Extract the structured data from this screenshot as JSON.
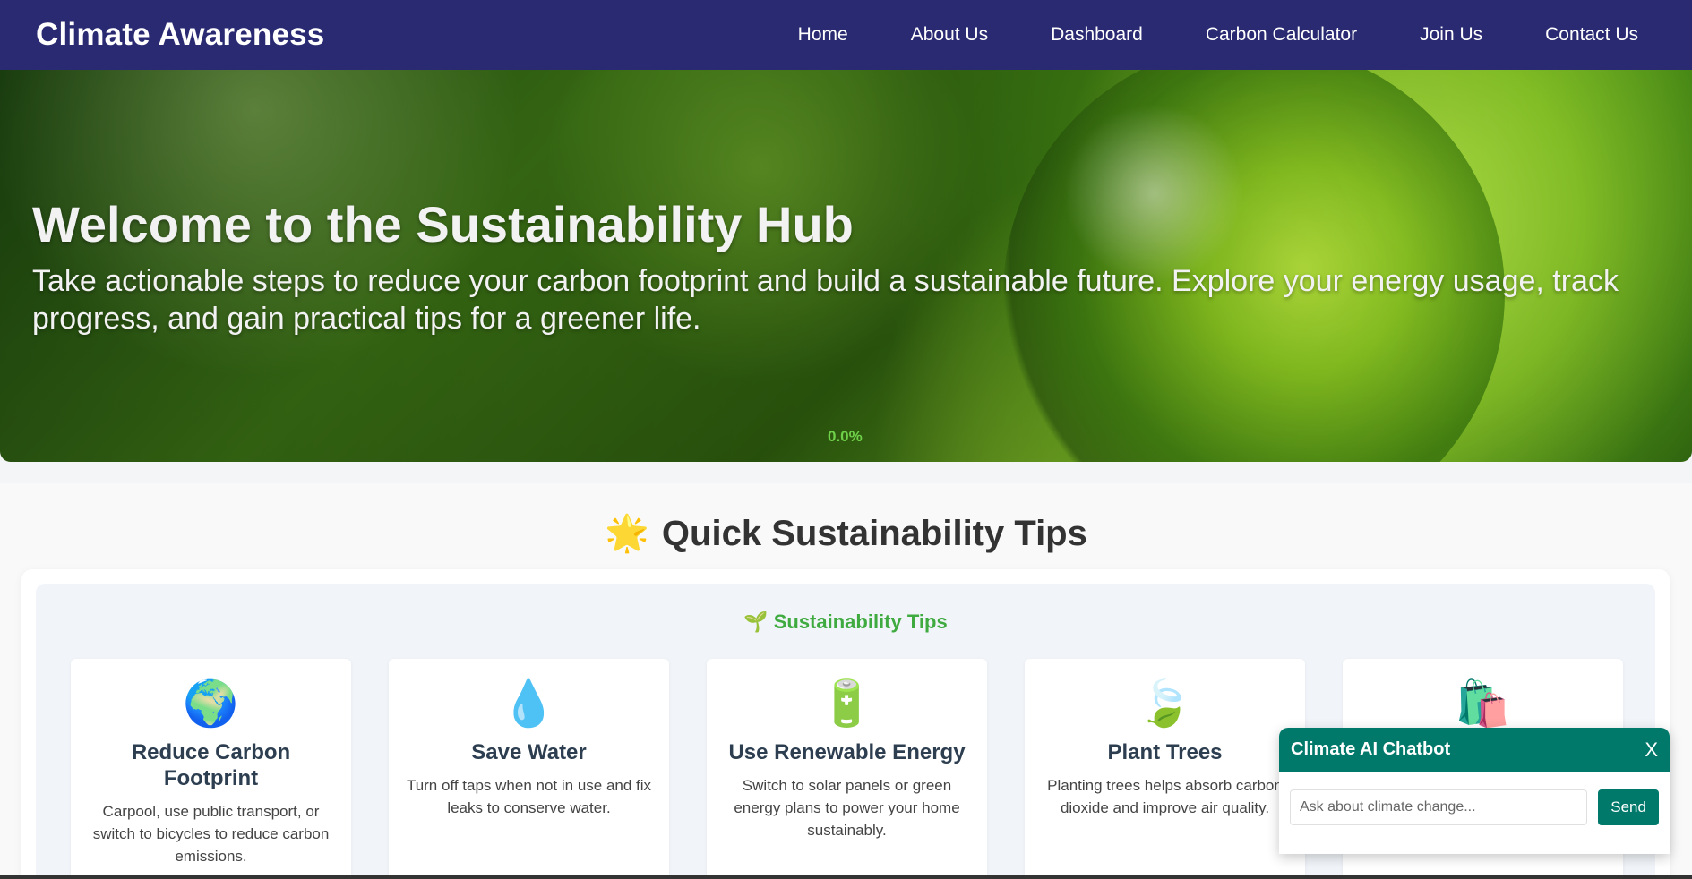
{
  "brand": "Climate Awareness",
  "nav": {
    "items": [
      "Home",
      "About Us",
      "Dashboard",
      "Carbon Calculator",
      "Join Us",
      "Contact Us"
    ]
  },
  "hero": {
    "title": "Welcome to the Sustainability Hub",
    "text": "Take actionable steps to reduce your carbon footprint and build a sustainable future. Explore your energy usage, track progress, and gain practical tips for a greener life.",
    "progress": "0.0%"
  },
  "tips_section": {
    "title_icon": "🌟",
    "title": "Quick Sustainability Tips",
    "subtitle_icon": "🌱",
    "subtitle": "Sustainability Tips",
    "cards": [
      {
        "icon": "🌍",
        "icon_name": "globe-icon",
        "title": "Reduce Carbon Footprint",
        "text": "Carpool, use public transport, or switch to bicycles to reduce carbon emissions."
      },
      {
        "icon": "💧",
        "icon_name": "water-drop-icon",
        "title": "Save Water",
        "text": "Turn off taps when not in use and fix leaks to conserve water."
      },
      {
        "icon": "🔋",
        "icon_name": "battery-icon",
        "title": "Use Renewable Energy",
        "text": "Switch to solar panels or green energy plans to power your home sustainably."
      },
      {
        "icon": "🍃",
        "icon_name": "leaves-icon",
        "title": "Plant Trees",
        "text": "Planting trees helps absorb carbon dioxide and improve air quality."
      },
      {
        "icon": "🛍️",
        "icon_name": "shopping-bags-icon",
        "title": "",
        "text": ""
      }
    ]
  },
  "chatbot": {
    "title": "Climate AI Chatbot",
    "close": "X",
    "placeholder": "Ask about climate change...",
    "send": "Send"
  },
  "colors": {
    "navbar": "#2a2a72",
    "accent_green": "#3faa3f",
    "chat_teal": "#00796b"
  }
}
